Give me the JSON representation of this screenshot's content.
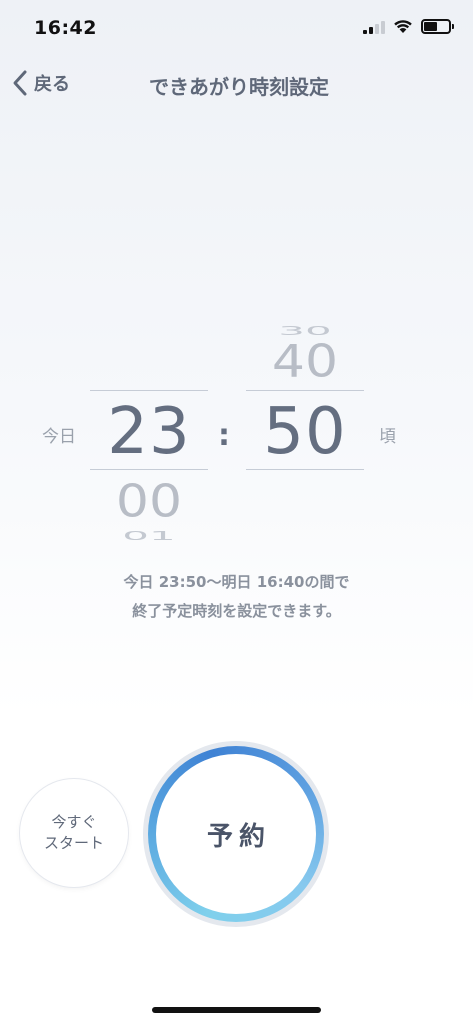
{
  "status_bar": {
    "time": "16:42",
    "signal_bars": 4,
    "signal_active": 2,
    "battery_level": 0.55
  },
  "nav": {
    "back_label": "戻る",
    "title": "できあがり時刻設定"
  },
  "picker": {
    "left_label": "今日",
    "right_label": "頃",
    "separator": ":",
    "hour": {
      "far_above": "",
      "above": "",
      "selected": "23",
      "below": "00",
      "far_below": "01"
    },
    "minute": {
      "far_above": "30",
      "above": "40",
      "selected": "50",
      "below": "",
      "far_below": ""
    }
  },
  "info": {
    "line1": "今日 23:50〜明日 16:40の間で",
    "line2": "終了予定時刻を設定できます。"
  },
  "buttons": {
    "start_now": "今すぐ\nスタート",
    "reserve": "予約"
  },
  "colors": {
    "accent_ring_start": "#7fd0ec",
    "accent_ring_end": "#3f82d4",
    "text_primary": "#5f6879"
  }
}
